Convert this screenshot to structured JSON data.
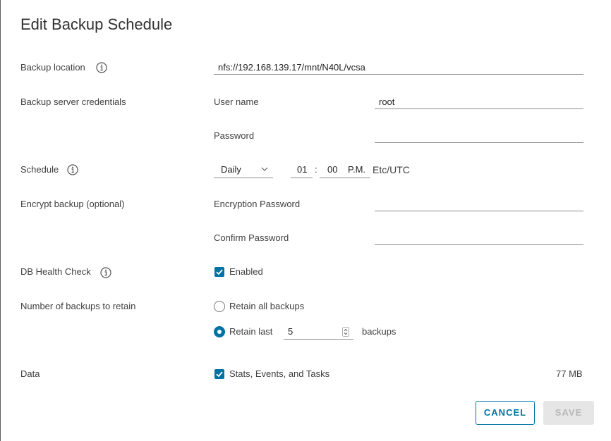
{
  "dialog": {
    "title": "Edit Backup Schedule"
  },
  "backup_location": {
    "label": "Backup location",
    "value": "nfs://192.168.139.17/mnt/N40L/vcsa"
  },
  "credentials": {
    "label": "Backup server credentials",
    "username_label": "User name",
    "username_value": "root",
    "password_label": "Password",
    "password_value": ""
  },
  "schedule": {
    "label": "Schedule",
    "frequency": "Daily",
    "hour": "01",
    "separator": ":",
    "minute": "00",
    "ampm": "P.M.",
    "timezone": "Etc/UTC"
  },
  "encrypt": {
    "label": "Encrypt backup (optional)",
    "encryption_password_label": "Encryption Password",
    "confirm_password_label": "Confirm Password"
  },
  "db_health": {
    "label": "DB Health Check",
    "checkbox_label": "Enabled",
    "checked": true
  },
  "retain": {
    "label": "Number of backups to retain",
    "option_all": "Retain all backups",
    "option_last": "Retain last",
    "last_value": "5",
    "suffix": "backups",
    "selected": "last"
  },
  "data": {
    "label": "Data",
    "checkbox_label": "Stats, Events, and Tasks",
    "size": "77 MB",
    "checked": true
  },
  "buttons": {
    "cancel": "CANCEL",
    "save": "SAVE"
  },
  "colors": {
    "accent": "#0072a3",
    "disabled_bg": "#e6e6e6",
    "disabled_text": "#b8b8b8"
  }
}
